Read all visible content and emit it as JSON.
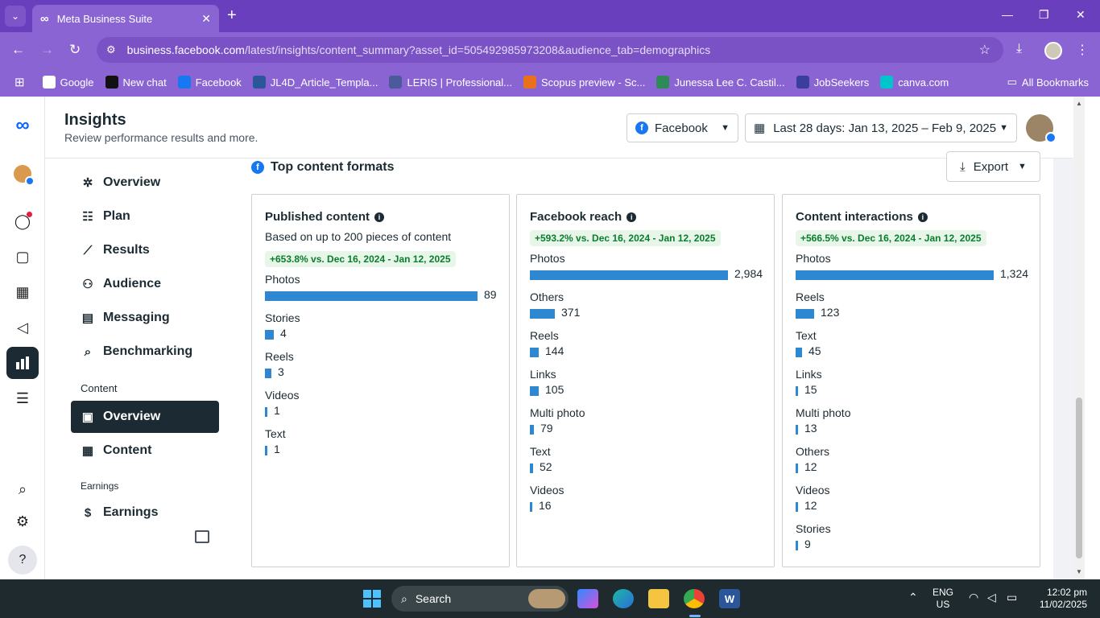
{
  "browser": {
    "tab_title": "Meta Business Suite",
    "url_host": "business.facebook.com",
    "url_rest": "/latest/insights/content_summary?asset_id=505492985973208&audience_tab=demographics",
    "bookmarks": [
      {
        "label": "Google",
        "icon": "google-icon",
        "color": "#ffffff"
      },
      {
        "label": "New chat",
        "icon": "chatgpt-icon",
        "color": "#111111"
      },
      {
        "label": "Facebook",
        "icon": "facebook-icon",
        "color": "#1877f2"
      },
      {
        "label": "JL4D_Article_Templa...",
        "icon": "word-icon",
        "color": "#2b579a"
      },
      {
        "label": "LERIS | Professional...",
        "icon": "leris-icon",
        "color": "#4a5a9a"
      },
      {
        "label": "Scopus preview - Sc...",
        "icon": "scopus-icon",
        "color": "#e9711c"
      },
      {
        "label": "Junessa Lee C. Castil...",
        "icon": "profile-icon",
        "color": "#2e8b57"
      },
      {
        "label": "JobSeekers",
        "icon": "jobseekers-icon",
        "color": "#3b3f9c"
      },
      {
        "label": "canva.com",
        "icon": "canva-icon",
        "color": "#00c4cc"
      }
    ],
    "all_bookmarks": "All Bookmarks"
  },
  "header": {
    "title": "Insights",
    "subtitle": "Review performance results and more.",
    "platform": "Facebook",
    "date_range": "Last 28 days: Jan 13, 2025 – Feb 9, 2025"
  },
  "sidebar": {
    "items": [
      {
        "label": "Overview",
        "icon": "overview-icon"
      },
      {
        "label": "Plan",
        "icon": "plan-icon"
      },
      {
        "label": "Results",
        "icon": "results-icon"
      },
      {
        "label": "Audience",
        "icon": "audience-icon"
      },
      {
        "label": "Messaging",
        "icon": "messaging-icon"
      },
      {
        "label": "Benchmarking",
        "icon": "benchmarking-icon"
      }
    ],
    "content_section": "Content",
    "content_items": [
      {
        "label": "Overview",
        "icon": "content-overview-icon",
        "active": true
      },
      {
        "label": "Content",
        "icon": "content-table-icon"
      }
    ],
    "earnings_section": "Earnings",
    "earnings_item": "Earnings"
  },
  "main": {
    "section_title": "Top content formats",
    "export_label": "Export",
    "cards": [
      {
        "title": "Published content",
        "subtitle": "Based on up to 200 pieces of content",
        "change": "+653.8% vs. Dec 16, 2024 - Jan 12, 2025",
        "rows": [
          {
            "label": "Photos",
            "value": 89,
            "display": "89"
          },
          {
            "label": "Stories",
            "value": 4,
            "display": "4"
          },
          {
            "label": "Reels",
            "value": 3,
            "display": "3"
          },
          {
            "label": "Videos",
            "value": 1,
            "display": "1"
          },
          {
            "label": "Text",
            "value": 1,
            "display": "1"
          }
        ]
      },
      {
        "title": "Facebook reach",
        "subtitle": "",
        "change": "+593.2% vs. Dec 16, 2024 - Jan 12, 2025",
        "rows": [
          {
            "label": "Photos",
            "value": 2984,
            "display": "2,984"
          },
          {
            "label": "Others",
            "value": 371,
            "display": "371"
          },
          {
            "label": "Reels",
            "value": 144,
            "display": "144"
          },
          {
            "label": "Links",
            "value": 105,
            "display": "105"
          },
          {
            "label": "Multi photo",
            "value": 79,
            "display": "79"
          },
          {
            "label": "Text",
            "value": 52,
            "display": "52"
          },
          {
            "label": "Videos",
            "value": 16,
            "display": "16"
          }
        ]
      },
      {
        "title": "Content interactions",
        "subtitle": "",
        "change": "+566.5% vs. Dec 16, 2024 - Jan 12, 2025",
        "rows": [
          {
            "label": "Photos",
            "value": 1324,
            "display": "1,324"
          },
          {
            "label": "Reels",
            "value": 123,
            "display": "123"
          },
          {
            "label": "Text",
            "value": 45,
            "display": "45"
          },
          {
            "label": "Links",
            "value": 15,
            "display": "15"
          },
          {
            "label": "Multi photo",
            "value": 13,
            "display": "13"
          },
          {
            "label": "Others",
            "value": 12,
            "display": "12"
          },
          {
            "label": "Videos",
            "value": 12,
            "display": "12"
          },
          {
            "label": "Stories",
            "value": 9,
            "display": "9"
          }
        ]
      }
    ]
  },
  "taskbar": {
    "search_label": "Search",
    "lang": "ENG",
    "region": "US",
    "time": "12:02 pm",
    "date": "11/02/2025"
  },
  "colors": {
    "accent": "#1877f2",
    "bar": "#2d88d1",
    "chrome": "#8b64d4",
    "badge_bg": "#e8f6ea",
    "badge_text": "#0a7d2c"
  }
}
